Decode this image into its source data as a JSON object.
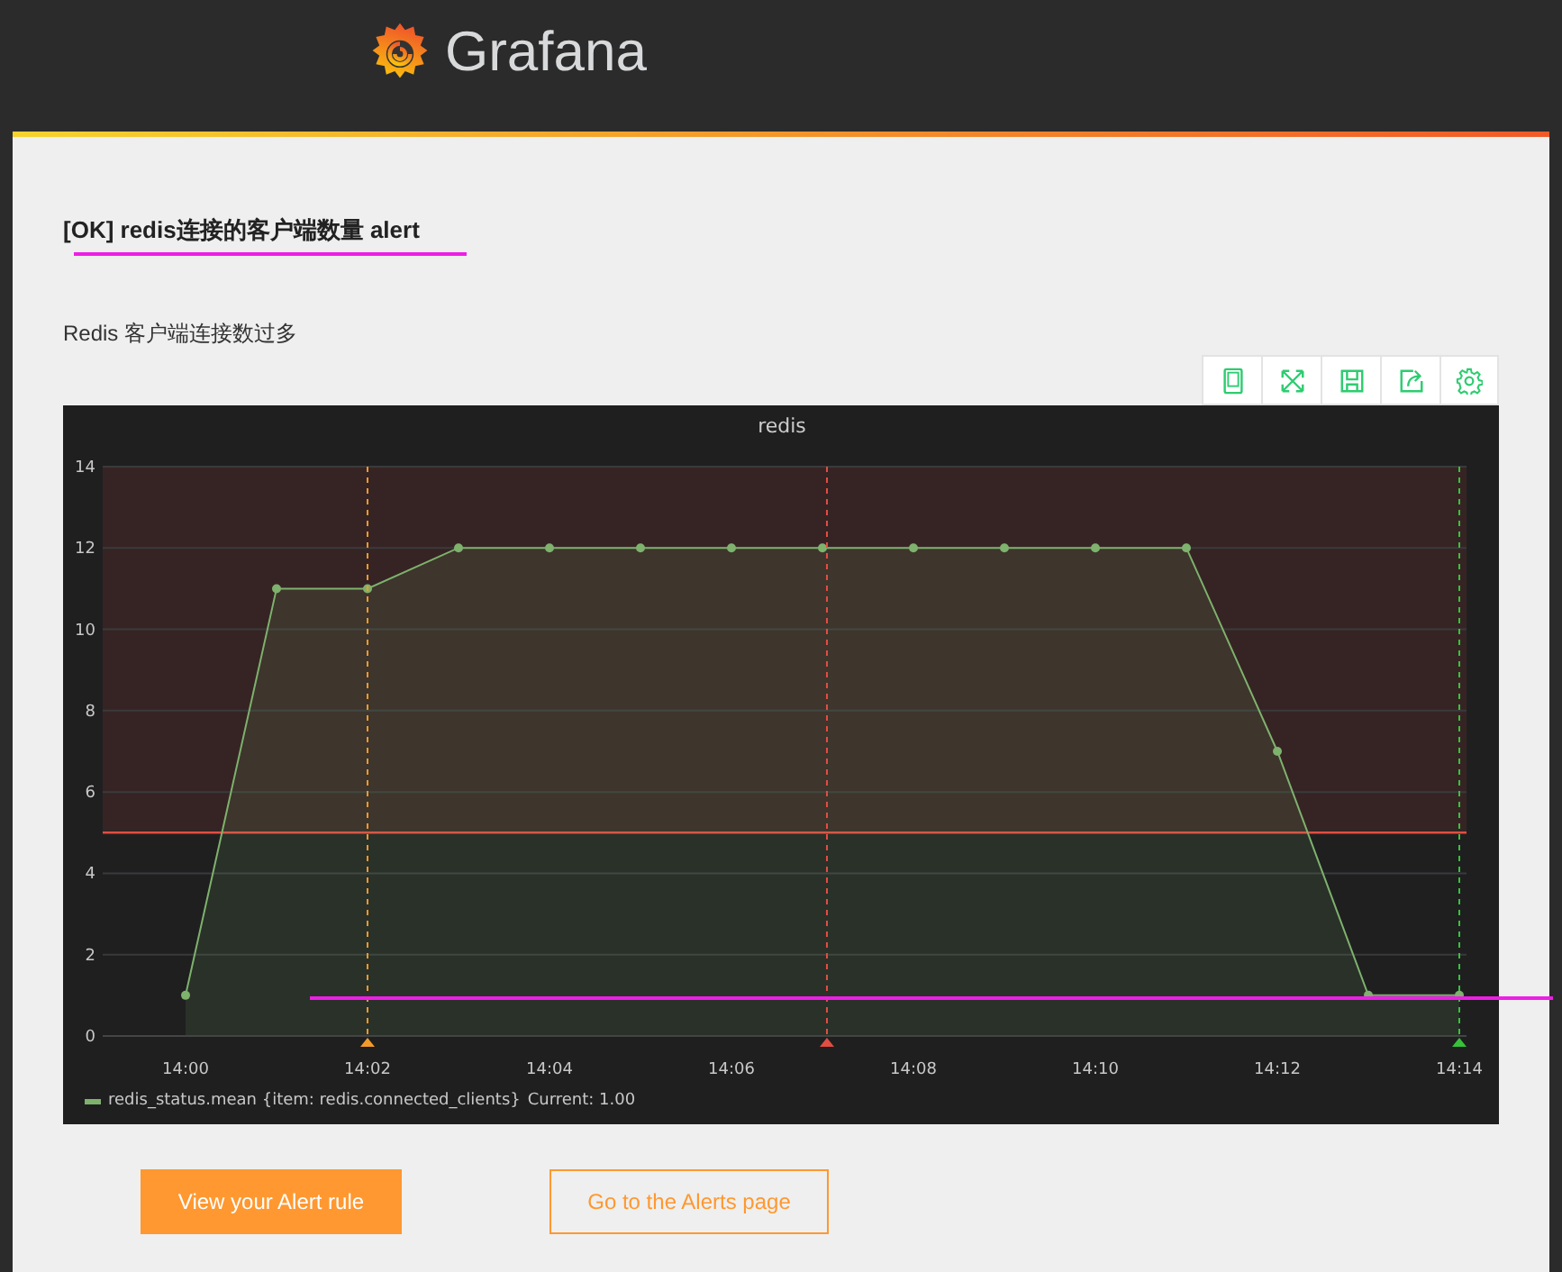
{
  "header": {
    "logo_text": "Grafana"
  },
  "alert": {
    "title": "[OK] redis连接的客户端数量 alert",
    "description": "Redis 客户端连接数过多"
  },
  "panel": {
    "title": "redis",
    "chart_data": {
      "type": "area",
      "categories": [
        "14:00",
        null,
        "14:02",
        null,
        "14:04",
        null,
        "14:06",
        null,
        "14:08",
        null,
        "14:10",
        null,
        "14:12",
        null,
        "14:14"
      ],
      "series": [
        {
          "name": "redis_status.mean {item: redis.connected_clients}",
          "color": "#7eb26d",
          "values": [
            1,
            11,
            11,
            12,
            12,
            12,
            12,
            12,
            12,
            12,
            12,
            12,
            7,
            1,
            1
          ]
        }
      ],
      "ylim": [
        0,
        14
      ],
      "yticks": [
        0,
        2,
        4,
        6,
        8,
        10,
        12,
        14
      ],
      "grid": true,
      "bands": [
        {
          "axis": "y",
          "from": 5,
          "to": 14,
          "color": "#e24d42"
        }
      ],
      "ref_lines": [
        {
          "axis": "y",
          "value": 5,
          "color": "#e24d42"
        },
        {
          "axis": "x",
          "value": "14:02",
          "color": "#f29b2c"
        },
        {
          "axis": "x",
          "value": "14:14",
          "color": "#37c23a"
        }
      ]
    },
    "legend": [
      {
        "current": "Current: 1.00"
      }
    ]
  },
  "buttons": [
    {
      "label": "View your Alert rule",
      "kind": "primary"
    },
    {
      "label": "Go to the Alerts page",
      "kind": "secondary"
    }
  ]
}
